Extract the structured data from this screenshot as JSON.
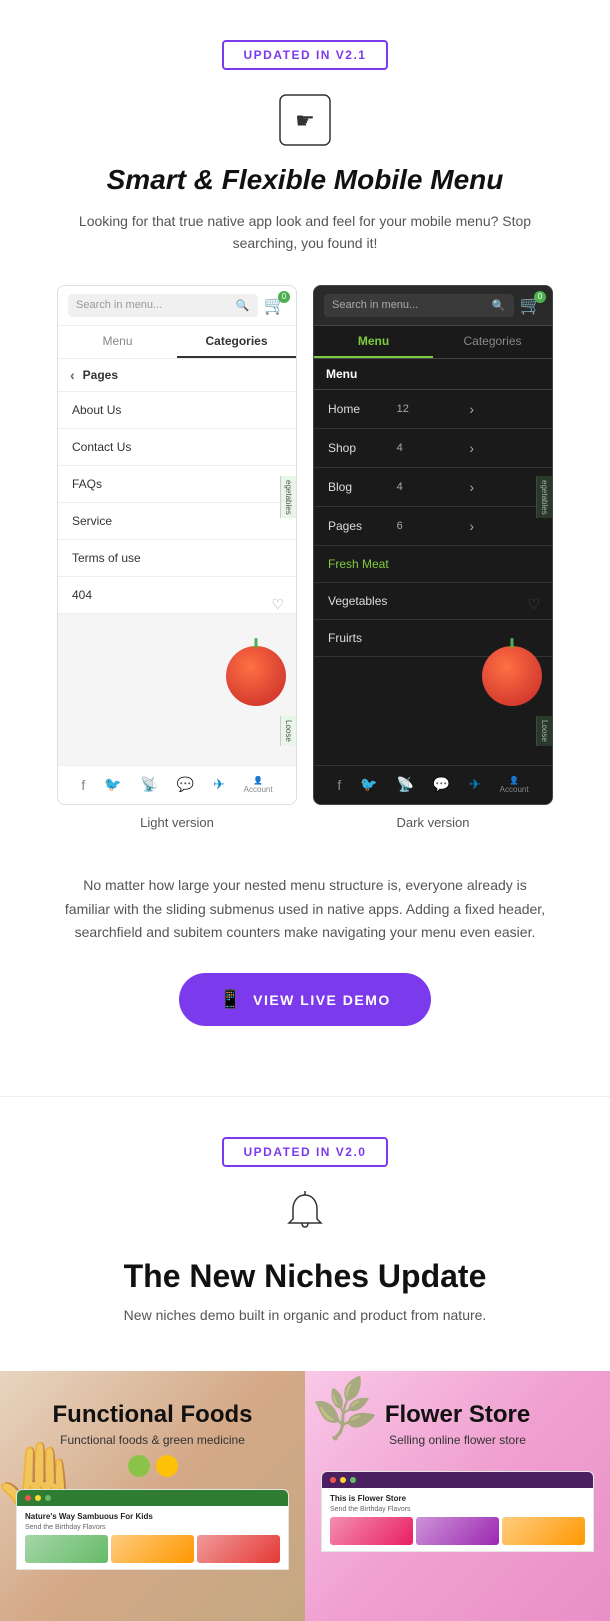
{
  "section1": {
    "badge": "UPDATED IN V2.1",
    "title": "Smart & Flexible Mobile Menu",
    "description": "Looking for that true native app look and feel for your mobile menu? Stop searching, you found it!",
    "light_label": "Light version",
    "dark_label": "Dark version",
    "para": "No matter how large your nested menu structure is, everyone already is familiar with the sliding submenus used in native apps. Adding a fixed header, searchfield and subitem counters make navigating your menu even easier.",
    "cta_label": "VIEW LIVE DEMO",
    "light_phone": {
      "search_placeholder": "Search in menu...",
      "cart_count": "0",
      "tab1": "Menu",
      "tab2": "Categories",
      "submenu_title": "Pages",
      "items": [
        "About Us",
        "Contact Us",
        "FAQs",
        "Service",
        "Terms of use",
        "404"
      ],
      "side_label": "egetables",
      "bottom_label": "Loose"
    },
    "dark_phone": {
      "search_placeholder": "Search in menu...",
      "cart_count": "0",
      "tab1": "Menu",
      "tab2": "Categories",
      "submenu_title": "Menu",
      "items": [
        {
          "name": "Home",
          "count": "12",
          "has_arrow": true
        },
        {
          "name": "Shop",
          "count": "4",
          "has_arrow": true
        },
        {
          "name": "Blog",
          "count": "4",
          "has_arrow": true
        },
        {
          "name": "Pages",
          "count": "6",
          "has_arrow": true
        },
        {
          "name": "Fresh Meat",
          "count": "",
          "has_arrow": false,
          "green": true
        },
        {
          "name": "Vegetables",
          "count": "",
          "has_arrow": false
        },
        {
          "name": "Fruirts",
          "count": "",
          "has_arrow": false
        }
      ],
      "side_label": "egetables",
      "bottom_label": "Loose"
    }
  },
  "section2": {
    "badge": "UPDATED IN V2.0",
    "title": "The New Niches Update",
    "description": "New niches demo built in organic and product from nature.",
    "cards": [
      {
        "id": "food",
        "title": "Functional Foods",
        "subtitle": "Functional foods & green medicine",
        "mini_heading": "Nature's Way Sambuous For Kids",
        "mini_text": "Send the Birthday Flavors"
      },
      {
        "id": "flower",
        "title": "Flower Store",
        "subtitle": "Selling online flower store",
        "mini_heading": "This is Flower Store",
        "mini_text": "Send the Birthday Flavors"
      }
    ]
  },
  "icons": {
    "hand_touch": "☛",
    "bell": "🔔",
    "mobile": "📱",
    "search": "🔍",
    "cart": "🛒",
    "back": "‹",
    "arrow_right": "›",
    "facebook": "f",
    "twitter": "t",
    "rss": "r",
    "whatsapp": "w",
    "telegram": "tg",
    "account": "👤"
  }
}
